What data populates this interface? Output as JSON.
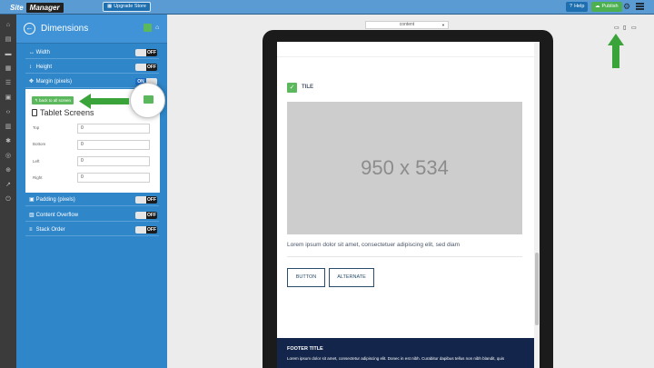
{
  "app": {
    "logo_part1": "Site",
    "logo_part2": "Manager",
    "upgrade_label": "Upgrade Store",
    "help_label": "Help",
    "publish_label": "Publish"
  },
  "colors": {
    "topbar": "#5a9bd4",
    "panel": "#2f86c9",
    "accent_green": "#5cb85c",
    "footer": "#13254a"
  },
  "panel": {
    "title": "Dimensions",
    "rows_top": [
      {
        "label": "Width",
        "toggle": "OFF",
        "icon": "width-icon"
      },
      {
        "label": "Height",
        "toggle": "OFF",
        "icon": "height-icon"
      },
      {
        "label": "Margin (pixels)",
        "toggle": "ON",
        "icon": "margin-icon"
      }
    ],
    "margin": {
      "back_button": "back to all screen",
      "screen_title": "Tablet Screens",
      "fields": [
        {
          "label": "Top",
          "value": "0"
        },
        {
          "label": "Bottom",
          "value": "0"
        },
        {
          "label": "Left",
          "value": "0"
        },
        {
          "label": "Right",
          "value": "0"
        }
      ]
    },
    "rows_bottom": [
      {
        "label": "Padding (pixels)",
        "toggle": "OFF",
        "icon": "padding-icon"
      },
      {
        "label": "Content Overflow",
        "toggle": "OFF",
        "icon": "overflow-icon"
      },
      {
        "label": "Stack Order",
        "toggle": "OFF",
        "icon": "stack-icon"
      }
    ]
  },
  "canvas": {
    "content_select": "content",
    "views": [
      "tablet-icon",
      "mobile-icon",
      "desktop-icon"
    ]
  },
  "preview": {
    "title": "TILE",
    "placeholder": "950 x 534",
    "lorem": "Lorem ipsum dolor sit amet, consectetuer adipiscing elit, sed diam",
    "button1": "BUTTON",
    "button2": "ALTERNATE",
    "footer_title": "FOOTER TITLE",
    "footer_text": "Lorem ipsum dolor sit amet, consectetur adipiscing elit. Donec in est nibh. Curabitur dapibus tellus non nibh blandit, quis"
  }
}
